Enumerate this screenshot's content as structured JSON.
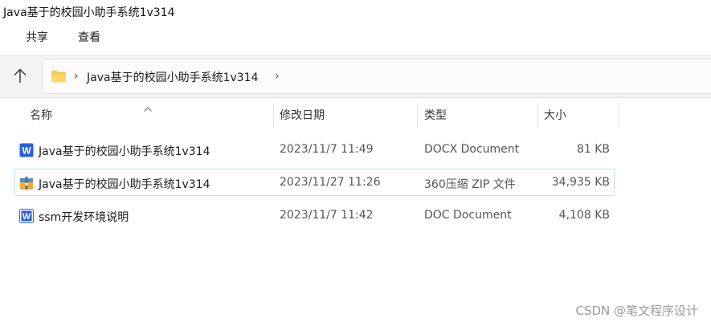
{
  "window": {
    "title": "Java基于的校园小助手系统1v314"
  },
  "ribbon": {
    "tabs": [
      {
        "label": "共享"
      },
      {
        "label": "查看"
      }
    ]
  },
  "addressbar": {
    "up_icon": "arrow-up-icon",
    "folder_icon": "folder-icon",
    "path": "Java基于的校园小助手系统1v314",
    "chevron": "›"
  },
  "columns": {
    "name": "名称",
    "date": "修改日期",
    "type": "类型",
    "size": "大小"
  },
  "files": [
    {
      "icon": "word-docx-icon",
      "name": "Java基于的校园小助手系统1v314",
      "date": "2023/11/7 11:49",
      "type": "DOCX Document",
      "size": "81 KB"
    },
    {
      "icon": "zip-archive-icon",
      "name": "Java基于的校园小助手系统1v314",
      "date": "2023/11/27 11:26",
      "type": "360压缩 ZIP 文件",
      "size": "34,935 KB"
    },
    {
      "icon": "word-doc-icon",
      "name": "ssm开发环境说明",
      "date": "2023/11/7 11:42",
      "type": "DOC Document",
      "size": "4,108 KB"
    }
  ],
  "watermark": "CSDN @笔文程序设计",
  "colors": {
    "word_blue": "#2b5fd9",
    "folder_yellow": "#f7c843",
    "hover_border": "#c7e0f4"
  }
}
